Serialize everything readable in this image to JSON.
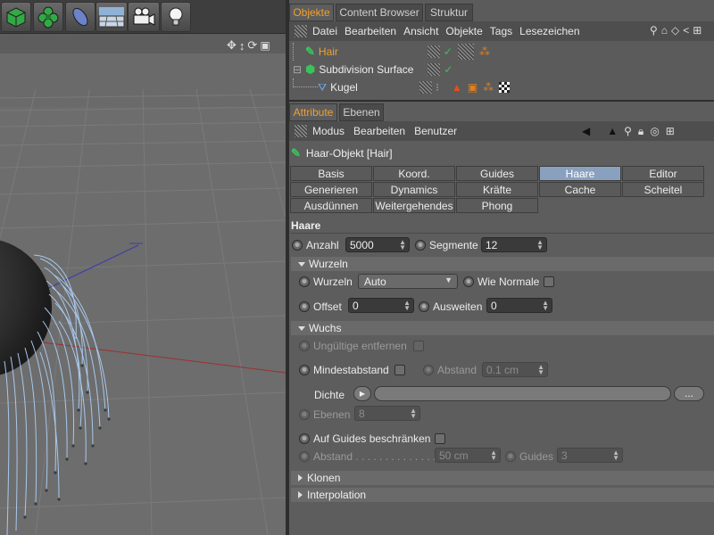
{
  "toolbar": {
    "icons": [
      "cube-icon",
      "gear-icon",
      "capsule-icon",
      "floor-grid-icon",
      "camera-icon",
      "light-bulb-icon"
    ]
  },
  "object_manager": {
    "tabs": [
      "Objekte",
      "Content Browser",
      "Struktur"
    ],
    "menu": [
      "Datei",
      "Bearbeiten",
      "Ansicht",
      "Objekte",
      "Tags",
      "Lesezeichen"
    ],
    "objects": [
      {
        "name": "Hair",
        "selected": true
      },
      {
        "name": "Subdivision Surface",
        "selected": false
      },
      {
        "name": "Kugel",
        "selected": false
      }
    ]
  },
  "attribute_manager": {
    "tabs": [
      "Attribute",
      "Ebenen"
    ],
    "menu": [
      "Modus",
      "Bearbeiten",
      "Benutzer"
    ],
    "title": "Haar-Objekt [Hair]",
    "param_tabs": [
      [
        "Basis",
        "Koord.",
        "Guides",
        "Haare",
        "Editor"
      ],
      [
        "Generieren",
        "Dynamics",
        "Kräfte",
        "Cache",
        "Scheitel"
      ],
      [
        "Ausdünnen",
        "Weitergehendes",
        "Phong"
      ]
    ],
    "active_tab": "Haare"
  },
  "haare": {
    "header": "Haare",
    "anzahl_label": "Anzahl",
    "anzahl_value": "5000",
    "segmente_label": "Segmente",
    "segmente_value": "12",
    "wurzeln_section": "Wurzeln",
    "wurzeln_label": "Wurzeln",
    "wurzeln_value": "Auto",
    "wie_normale_label": "Wie Normale",
    "offset_label": "Offset",
    "offset_value": "0",
    "ausweiten_label": "Ausweiten",
    "ausweiten_value": "0",
    "wuchs_section": "Wuchs",
    "ungueltige_label": "Ungültige entfernen",
    "mindestabstand_label": "Mindestabstand",
    "abstand_label": "Abstand",
    "abstand_value": "0.1 cm",
    "dichte_label": "Dichte",
    "dichte_more": "...",
    "ebenen_label": "Ebenen",
    "ebenen_value": "8",
    "auf_guides_label": "Auf Guides beschränken",
    "abstand2_label": "Abstand . . . . . . . . . . . . . .",
    "abstand2_value": "50 cm",
    "guides_label": "Guides",
    "guides_value": "3",
    "klonen_section": "Klonen",
    "interpolation_section": "Interpolation"
  },
  "colors": {
    "accent": "#f0a030",
    "active_tab": "#8aa0bf",
    "panel": "#5d5d5d"
  }
}
